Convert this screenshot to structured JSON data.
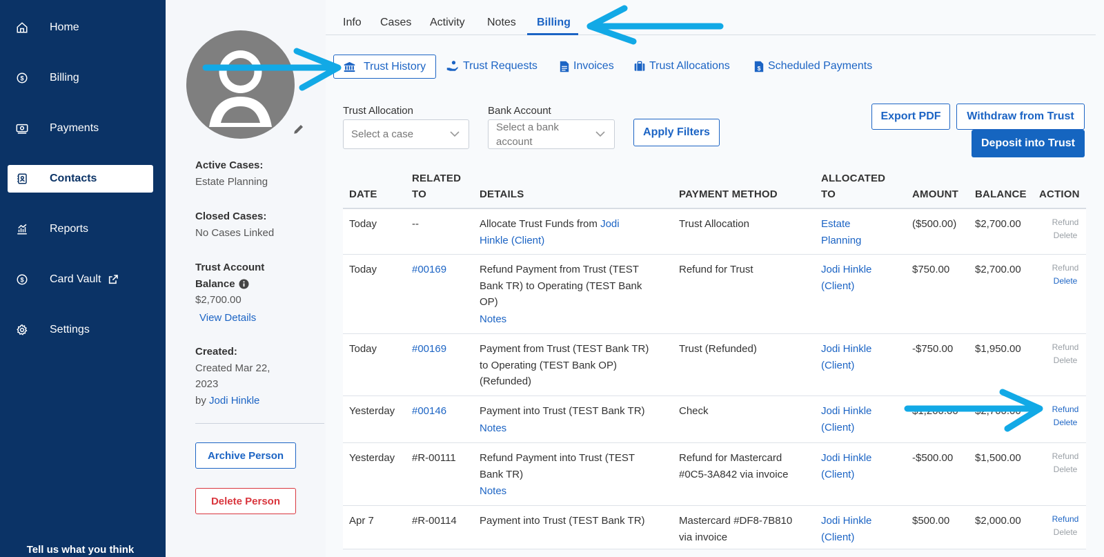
{
  "sidebar": {
    "items": [
      {
        "label": "Home",
        "icon": "home-icon"
      },
      {
        "label": "Billing",
        "icon": "dollar-circle-icon"
      },
      {
        "label": "Payments",
        "icon": "cash-icon"
      },
      {
        "label": "Contacts",
        "icon": "contacts-icon",
        "active": true
      },
      {
        "label": "Reports",
        "icon": "chart-icon"
      },
      {
        "label": "Card Vault",
        "icon": "dollar-circle-icon",
        "external": true
      },
      {
        "label": "Settings",
        "icon": "gear-icon"
      }
    ],
    "footer": "Tell us what you think"
  },
  "profile": {
    "active_cases_label": "Active Cases:",
    "active_cases_value": "Estate Planning",
    "closed_cases_label": "Closed Cases:",
    "closed_cases_value": "No Cases Linked",
    "trust_balance_label_1": "Trust Account",
    "trust_balance_label_2": "Balance",
    "trust_balance_value": "$2,700.00",
    "view_details": "View Details",
    "created_label": "Created:",
    "created_line1": "Created Mar 22,",
    "created_line2": "2023",
    "created_by_prefix": "by",
    "created_by_name": "Jodi Hinkle",
    "archive_button": "Archive Person",
    "delete_button": "Delete Person"
  },
  "tabs": [
    "Info",
    "Cases",
    "Activity",
    "Notes",
    "Billing"
  ],
  "active_tab": "Billing",
  "subtabs": [
    "Trust History",
    "Trust Requests",
    "Invoices",
    "Trust Allocations",
    "Scheduled Payments"
  ],
  "filters": {
    "trust_allocation_label": "Trust Allocation",
    "trust_allocation_placeholder": "Select a case",
    "bank_account_label": "Bank Account",
    "bank_account_placeholder_1": "Select a bank",
    "bank_account_placeholder_2": "account",
    "apply_button": "Apply Filters"
  },
  "actions": {
    "export_pdf": "Export PDF",
    "withdraw": "Withdraw from Trust",
    "deposit": "Deposit into Trust"
  },
  "table": {
    "headers": {
      "date": "DATE",
      "related_1": "RELATED",
      "related_2": "TO",
      "details": "DETAILS",
      "method": "PAYMENT METHOD",
      "allocated_1": "ALLOCATED",
      "allocated_2": "TO",
      "amount": "AMOUNT",
      "balance": "BALANCE",
      "action": "ACTION"
    },
    "refund_label": "Refund",
    "delete_label": "Delete",
    "notes_label": "Notes",
    "rows": [
      {
        "date": "Today",
        "related": "--",
        "details_1": "Allocate Trust Funds from",
        "details_link_1": "Jodi",
        "details_link_2": "Hinkle (Client)",
        "method_1": "Trust Allocation",
        "method_2": "",
        "alloc_1": "Estate",
        "alloc_2": "Planning",
        "amount": "($500.00)",
        "balance": "$2,700.00"
      },
      {
        "date": "Today",
        "related": "#00169",
        "details_1": "Refund Payment from Trust (TEST",
        "details_2": "Bank TR) to Operating (TEST Bank",
        "details_3": "OP)",
        "method_1": "Refund for Trust",
        "method_2": "",
        "alloc_1": "Jodi Hinkle",
        "alloc_2": "(Client)",
        "amount": "$750.00",
        "balance": "$2,700.00"
      },
      {
        "date": "Today",
        "related": "#00169",
        "details_1": "Payment from Trust (TEST Bank TR)",
        "details_2": "to Operating (TEST Bank OP)",
        "details_3": "(Refunded)",
        "method_1": "Trust (Refunded)",
        "method_2": "",
        "alloc_1": "Jodi Hinkle",
        "alloc_2": "(Client)",
        "amount": "-$750.00",
        "balance": "$1,950.00"
      },
      {
        "date": "Yesterday",
        "related": "#00146",
        "details_1": "Payment into Trust (TEST Bank TR)",
        "details_2": "",
        "details_3": "",
        "method_1": "Check",
        "method_2": "",
        "alloc_1": "Jodi Hinkle",
        "alloc_2": "(Client)",
        "amount": "$1,200.00",
        "balance": "$2,700.00"
      },
      {
        "date": "Yesterday",
        "related": "#R-00111",
        "details_1": "Refund Payment into Trust (TEST",
        "details_2": "Bank TR)",
        "details_3": "",
        "method_1": "Refund for Mastercard",
        "method_2": "#0C5-3A842 via invoice",
        "alloc_1": "Jodi Hinkle",
        "alloc_2": "(Client)",
        "amount": "-$500.00",
        "balance": "$1,500.00"
      },
      {
        "date": "Apr 7",
        "related": "#R-00114",
        "details_1": "Payment into Trust (TEST Bank TR)",
        "details_2": "",
        "details_3": "",
        "method_1": "Mastercard #DF8-7B810",
        "method_2": "via invoice",
        "alloc_1": "Jodi Hinkle",
        "alloc_2": "(Client)",
        "amount": "$500.00",
        "balance": "$2,000.00"
      }
    ]
  },
  "colors": {
    "sidebar_bg": "#0b3366",
    "accent": "#1c64c4",
    "primary_button": "#1565c0",
    "danger": "#d9363e",
    "annotation_arrow": "#12a9e6"
  }
}
